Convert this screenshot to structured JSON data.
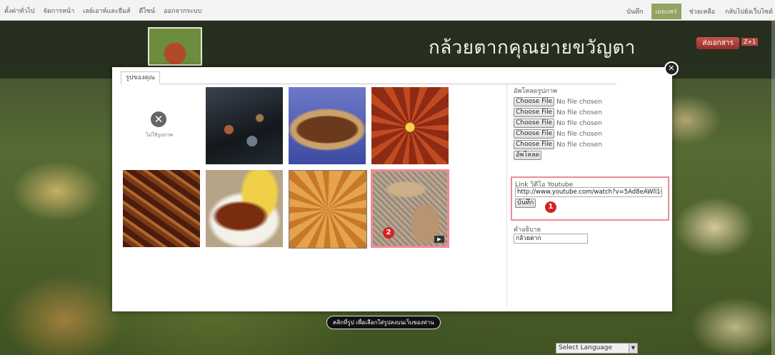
{
  "top_menu": {
    "left": [
      "ตั้งค่าทั่วไป",
      "จัดการหน้า",
      "เลย์เอาท์และธีมส์",
      "ดีไซน์",
      "ออกจากระบบ"
    ],
    "right": [
      "บันทึก",
      "เผยแพร่",
      "ช่วยเหลือ",
      "กลับไปยังเว็บไซต์"
    ]
  },
  "banner": {
    "title": "กล้วยตากคุณยายขวัญตา",
    "doc_button": "ส่งเอกสาร",
    "small_tag": "Z+1"
  },
  "modal": {
    "tab": "รูปของคุณ",
    "no_photo_label": "ไม่ใช้รูปภาพ",
    "upload": {
      "label": "อัพโหลดรูปภาพ",
      "choose_label": "Choose File",
      "no_file": "No file chosen",
      "rows": 5,
      "submit": "อัพโหลด"
    },
    "youtube": {
      "label": "Link วิดีโอ Youtube",
      "value": "http://www.youtube.com/watch?v=5Ad8eAWll1(",
      "save": "บันทึก",
      "marker": "1"
    },
    "caption": {
      "label": "คำอธิบาย",
      "value": "กล้วยตาก"
    },
    "video_marker": "2",
    "play_icon": "▶"
  },
  "hint": "คลิกที่รูป เพื่อเลือกใส่รูปลงบนเว็บของท่าน",
  "language": "Select Language",
  "colors": {
    "accent": "#93a361",
    "highlight": "#f08a95",
    "marker": "#d32222"
  }
}
